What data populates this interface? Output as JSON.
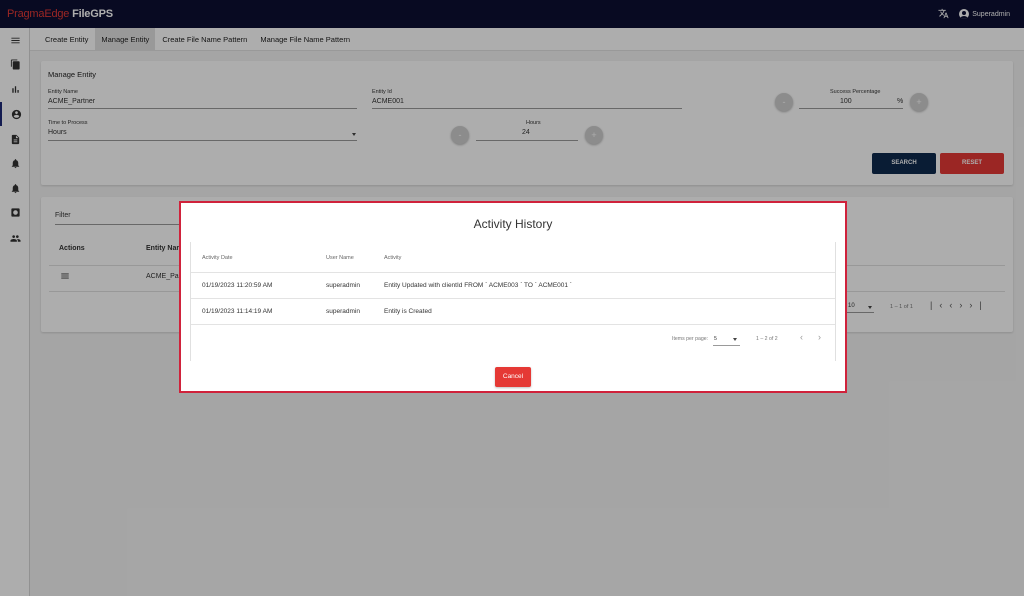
{
  "app": {
    "brand_part1": "PragmaEdge",
    "brand_part2": " FileGPS",
    "user": "Superadmin"
  },
  "tabs": [
    "Create Entity",
    "Manage Entity",
    "Create File Name Pattern",
    "Manage File Name Pattern"
  ],
  "form": {
    "title": "Manage Entity",
    "entity_name_label": "Entity Name",
    "entity_name_value": "ACME_Partner",
    "entity_id_label": "Entity Id",
    "entity_id_value": "ACME001",
    "success_label": "Success Percentage",
    "success_value": "100",
    "percent_sign": "%",
    "time_label": "Time to Process",
    "time_value": "Hours",
    "hours_label": "Hours",
    "hours_value": "24",
    "minus": "-",
    "plus": "+",
    "search_label": "SEARCH",
    "reset_label": "RESET"
  },
  "list": {
    "filter_label": "Filter",
    "col_actions": "Actions",
    "col_entity_name": "Entity Nam",
    "row_entity": "ACME_Part",
    "page_size": "10",
    "range": "1 – 1 of 1"
  },
  "modal": {
    "title": "Activity History",
    "headers": [
      "Activity Date",
      "User Name",
      "Activity"
    ],
    "rows": [
      [
        "01/19/2023 11:20:59 AM",
        "superadmin",
        "Entity Updated with clientId FROM ` ACME003 ` TO ` ACME001 `"
      ],
      [
        "01/19/2023 11:14:19 AM",
        "superadmin",
        "Entity is Created"
      ]
    ],
    "items_per_page_label": "Items per page:",
    "items_per_page_value": "5",
    "range": "1 – 2 of 2",
    "cancel_label": "Cancel"
  },
  "colors": {
    "topbar": "#0c1033",
    "brand_red": "#e53935",
    "search_btn": "#0e2a4d",
    "reset_btn": "#e53935",
    "modal_border": "#d0223b"
  },
  "icons": [
    "menu-icon",
    "file-icon",
    "bar-chart-icon",
    "account-circle-icon",
    "document-icon",
    "bell-icon",
    "bell-alt-icon",
    "shield-icon",
    "group-icon",
    "translate-icon"
  ]
}
